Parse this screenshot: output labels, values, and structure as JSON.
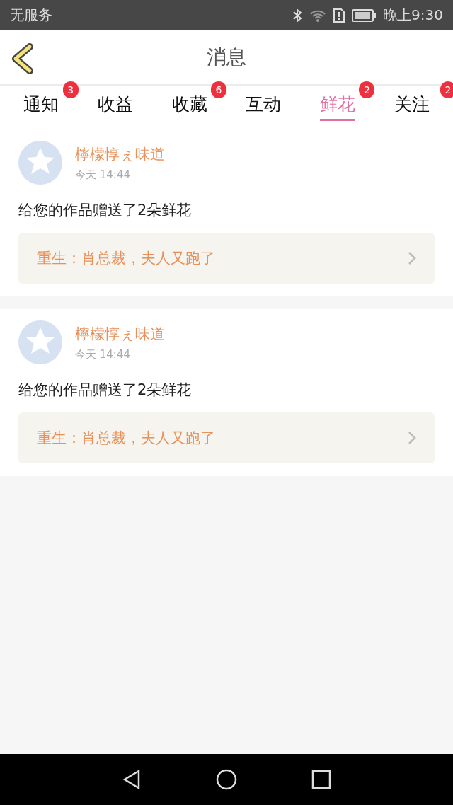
{
  "status_bar": {
    "carrier": "无服务",
    "time": "晚上9:30"
  },
  "header": {
    "title": "消息"
  },
  "tabs": [
    {
      "label": "通知",
      "badge": "3",
      "selected": false
    },
    {
      "label": "收益",
      "selected": false
    },
    {
      "label": "收藏",
      "badge": "6",
      "selected": false
    },
    {
      "label": "互动",
      "selected": false
    },
    {
      "label": "鲜花",
      "badge": "2",
      "selected": true
    },
    {
      "label": "关注",
      "badge": "2",
      "selected": false
    }
  ],
  "messages": [
    {
      "sender": "檸檬惇ぇ味道",
      "time": "今天 14:44",
      "text": "给您的作品赠送了2朵鲜花",
      "work": "重生：肖总裁，夫人又跑了"
    },
    {
      "sender": "檸檬惇ぇ味道",
      "time": "今天 14:44",
      "text": "给您的作品赠送了2朵鲜花",
      "work": "重生：肖总裁，夫人又跑了"
    }
  ]
}
